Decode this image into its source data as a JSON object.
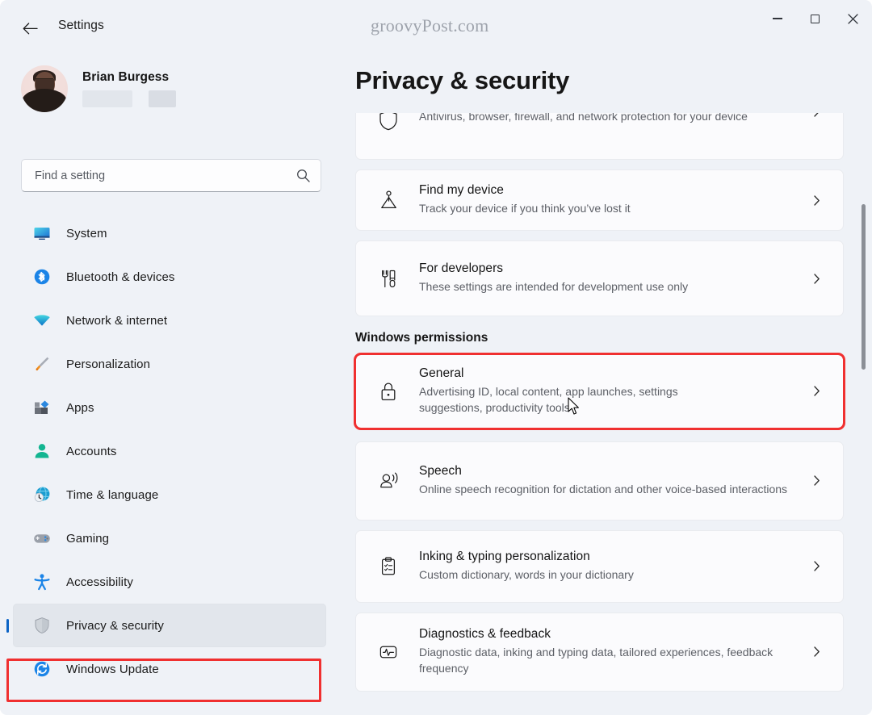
{
  "window": {
    "title": "Settings",
    "watermark": "groovyPost.com",
    "controls": {
      "minimize": "Minimize",
      "maximize": "Maximize",
      "close": "Close"
    },
    "back": "Back"
  },
  "account": {
    "name": "Brian Burgess",
    "redacted_fields": [
      "",
      ""
    ]
  },
  "search": {
    "placeholder": "Find a setting",
    "value": ""
  },
  "sidebar": {
    "items": [
      {
        "label": "System",
        "icon": "monitor-icon",
        "selected": false
      },
      {
        "label": "Bluetooth & devices",
        "icon": "bluetooth-icon",
        "selected": false
      },
      {
        "label": "Network & internet",
        "icon": "wifi-icon",
        "selected": false
      },
      {
        "label": "Personalization",
        "icon": "paintbrush-icon",
        "selected": false
      },
      {
        "label": "Apps",
        "icon": "apps-icon",
        "selected": false
      },
      {
        "label": "Accounts",
        "icon": "person-icon",
        "selected": false
      },
      {
        "label": "Time & language",
        "icon": "clock-globe-icon",
        "selected": false
      },
      {
        "label": "Gaming",
        "icon": "gamepad-icon",
        "selected": false
      },
      {
        "label": "Accessibility",
        "icon": "accessibility-icon",
        "selected": false
      },
      {
        "label": "Privacy & security",
        "icon": "shield-icon",
        "selected": true
      },
      {
        "label": "Windows Update",
        "icon": "update-icon",
        "selected": false
      }
    ]
  },
  "main": {
    "page_title": "Privacy & security",
    "clipped_card": {
      "desc": "Antivirus, browser, firewall, and network protection for your device",
      "icon": "shield-outline-icon"
    },
    "cards_top": [
      {
        "title": "Find my device",
        "desc": "Track your device if you think you’ve lost it",
        "icon": "find-device-icon"
      },
      {
        "title": "For developers",
        "desc": "These settings are intended for development use only",
        "icon": "developer-tools-icon"
      }
    ],
    "section_title": "Windows permissions",
    "cards_permissions": [
      {
        "title": "General",
        "desc": "Advertising ID, local content, app launches, settings suggestions, productivity tools",
        "icon": "lock-icon",
        "highlighted": true
      },
      {
        "title": "Speech",
        "desc": "Online speech recognition for dictation and other voice-based interactions",
        "icon": "speech-icon",
        "highlighted": false
      },
      {
        "title": "Inking & typing personalization",
        "desc": "Custom dictionary, words in your dictionary",
        "icon": "clipboard-icon",
        "highlighted": false
      },
      {
        "title": "Diagnostics & feedback",
        "desc": "Diagnostic data, inking and typing data, tailored experiences, feedback frequency",
        "icon": "pulse-icon",
        "highlighted": false
      }
    ]
  },
  "colors": {
    "window_bg": "#eff2f7",
    "card_bg": "#fbfbfd",
    "accent": "#0b63c5",
    "annotation_red": "#f03030",
    "text_primary": "#161616",
    "text_secondary": "#5c5f66"
  }
}
